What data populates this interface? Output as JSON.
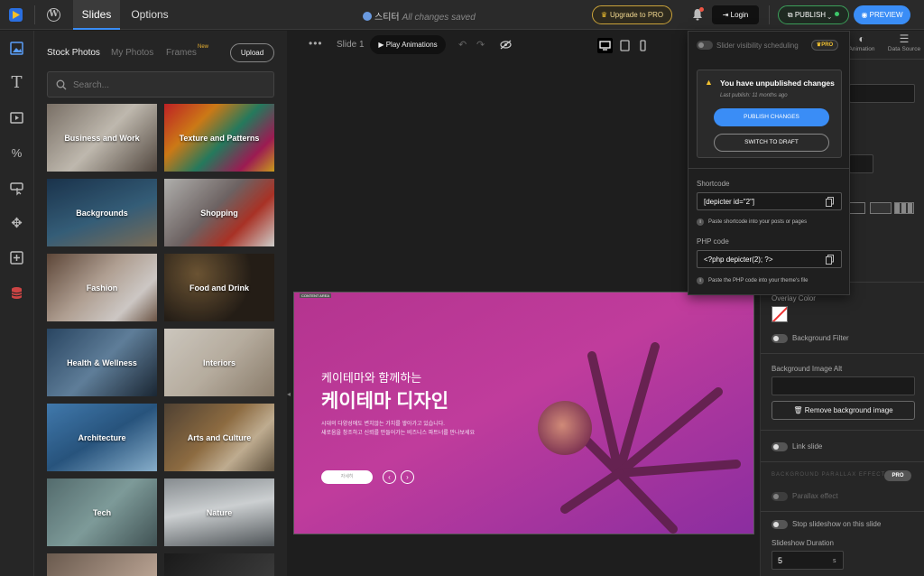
{
  "header": {
    "tabs": [
      {
        "label": "Slides"
      },
      {
        "label": "Options"
      }
    ],
    "doc_title": "스티터",
    "save_status": "All changes saved",
    "upgrade_label": "Upgrade to PRO",
    "login_label": "Login",
    "publish_label": "PUBLISH",
    "preview_label": "PREVIEW"
  },
  "rail": {
    "icons": [
      "image-icon",
      "text-icon",
      "video-icon",
      "shapes-icon",
      "button-icon",
      "move-icon",
      "add-box-icon",
      "database-icon"
    ]
  },
  "library": {
    "tabs": [
      {
        "label": "Stock Photos"
      },
      {
        "label": "My Photos"
      },
      {
        "label": "Frames"
      }
    ],
    "new_badge": "New",
    "upload_label": "Upload",
    "search_placeholder": "Search...",
    "categories": [
      {
        "label": "Business and Work"
      },
      {
        "label": "Texture and Patterns"
      },
      {
        "label": "Backgrounds"
      },
      {
        "label": "Shopping"
      },
      {
        "label": "Fashion"
      },
      {
        "label": "Food and Drink"
      },
      {
        "label": "Health & Wellness"
      },
      {
        "label": "Interiors"
      },
      {
        "label": "Architecture"
      },
      {
        "label": "Arts and Culture"
      },
      {
        "label": "Tech"
      },
      {
        "label": "Nature"
      }
    ]
  },
  "canvas_toolbar": {
    "slide_name": "Slide 1",
    "play_label": "Play Animations"
  },
  "slide": {
    "content_area_tag": "CONTENT AREA",
    "subtitle": "케이테마와 함께하는",
    "title": "케이테마 디자인",
    "body_line1": "시대의 다양성에도 변치않는 가치를 쌓아가고 있습니다.",
    "body_line2": "새로움을 창조하고 신뢰를 만들어가는 비즈니스 파트너를 만나보세요",
    "cta_label": "자세히"
  },
  "publish_dropdown": {
    "scheduling_label": "Slider visibility scheduling",
    "pro_label": "PRO",
    "unpublished_title": "You have unpublished changes",
    "last_publish": "Last publish: 11 months ago",
    "publish_changes_label": "PUBLISH CHANGES",
    "switch_draft_label": "SWITCH TO DRAFT",
    "shortcode_label": "Shortcode",
    "shortcode_value": "[depicter id=\"2\"]",
    "shortcode_hint": "Paste shortcode into your posts or pages",
    "php_label": "PHP code",
    "php_value": "<?php depicter(2); ?>",
    "php_hint": "Paste the PHP code into your theme's file"
  },
  "right_panel": {
    "tabs": [
      {
        "label": "Animation"
      },
      {
        "label": "Data Source"
      }
    ],
    "overlay_color_label": "Overlay Color",
    "background_filter_label": "Background Filter",
    "bg_alt_label": "Background Image Alt",
    "remove_bg_label": "Remove background image",
    "link_slide_label": "Link slide",
    "parallax_header": "BACKGROUND PARALLAX EFFECT",
    "parallax_pro_label": "PRO",
    "parallax_label": "Parallax effect",
    "stop_slideshow_label": "Stop slideshow on this slide",
    "duration_label": "Slideshow Duration",
    "duration_value": "5",
    "duration_unit": "s"
  }
}
